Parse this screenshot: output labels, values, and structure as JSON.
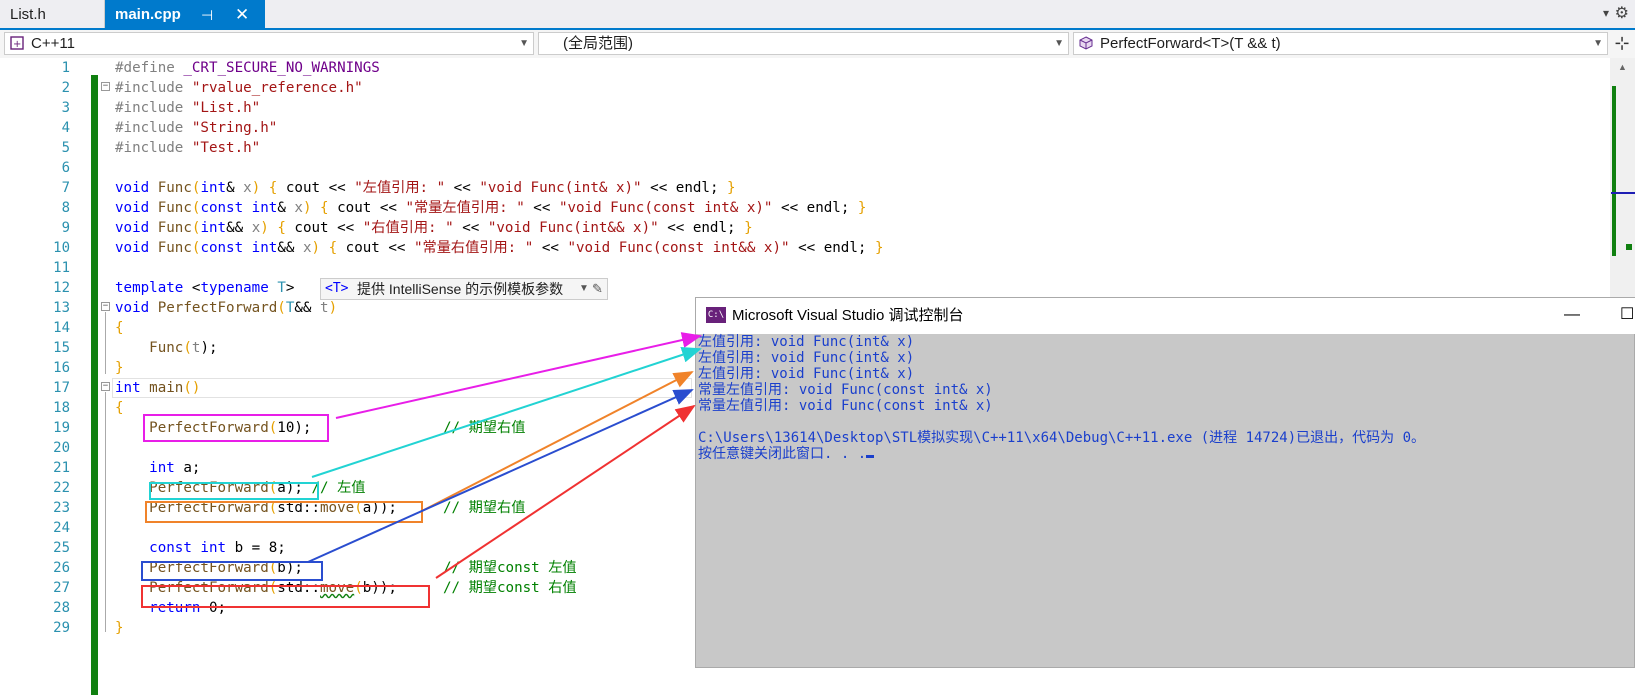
{
  "tabs": [
    {
      "label": "List.h",
      "active": false
    },
    {
      "label": "main.cpp",
      "active": true
    }
  ],
  "tab_icons": {
    "pin": "⊣",
    "close": "✕",
    "dropdown": "▾",
    "settings": "⚙"
  },
  "nav": {
    "project": "C++11",
    "scope": "(全局范围)",
    "member": "PerfectForward<T>(T && t)"
  },
  "line_numbers": [
    "1",
    "2",
    "3",
    "4",
    "5",
    "6",
    "7",
    "8",
    "9",
    "10",
    "11",
    "12",
    "13",
    "14",
    "15",
    "16",
    "17",
    "18",
    "19",
    "20",
    "21",
    "22",
    "23",
    "24",
    "25",
    "26",
    "27",
    "28",
    "29"
  ],
  "code": {
    "l1": {
      "pp": "#define ",
      "mac": "_CRT_SECURE_NO_WARNINGS"
    },
    "l2": {
      "pp": "#include ",
      "str": "\"rvalue_reference.h\""
    },
    "l3": {
      "pp": "#include ",
      "str": "\"List.h\""
    },
    "l4": {
      "pp": "#include ",
      "str": "\"String.h\""
    },
    "l5": {
      "pp": "#include ",
      "str": "\"Test.h\""
    },
    "l7": {
      "a": "void",
      "b": " Func",
      "c": "(",
      "d": "int",
      "e": "& ",
      "f": "x",
      "g": ") ",
      "h": "{",
      "i": " cout << ",
      "j": "\"左值引用: \"",
      "k": " << ",
      "l": "\"void Func(int& x)\"",
      "m": " << endl; ",
      "n": "}"
    },
    "l8": {
      "a": "void",
      "b": " Func",
      "c": "(",
      "d": "const int",
      "e": "& ",
      "f": "x",
      "g": ") ",
      "h": "{",
      "i": " cout << ",
      "j": "\"常量左值引用: \"",
      "k": " << ",
      "l": "\"void Func(const int& x)\"",
      "m": " << endl; ",
      "n": "}"
    },
    "l9": {
      "a": "void",
      "b": " Func",
      "c": "(",
      "d": "int",
      "e": "&& ",
      "f": "x",
      "g": ") ",
      "h": "{",
      "i": " cout << ",
      "j": "\"右值引用: \"",
      "k": " << ",
      "l": "\"void Func(int&& x)\"",
      "m": " << endl; ",
      "n": "}"
    },
    "l10": {
      "a": "void",
      "b": " Func",
      "c": "(",
      "d": "const int",
      "e": "&& ",
      "f": "x",
      "g": ") ",
      "h": "{",
      "i": " cout << ",
      "j": "\"常量右值引用: \"",
      "k": " << ",
      "l": "\"void Func(const int&& x)\"",
      "m": " << endl; ",
      "n": "}"
    },
    "l12": {
      "a": "template",
      "b": " <",
      "c": "typename",
      "d": " ",
      "e": "T",
      "f": ">"
    },
    "l13": {
      "a": "void",
      "b": " PerfectForward",
      "c": "(",
      "d": "T",
      "e": "&& ",
      "f": "t",
      "g": ")"
    },
    "l14": "{",
    "l15": {
      "a": "    Func",
      "b": "(",
      "c": "t",
      "d": ");"
    },
    "l16": "}",
    "l17": {
      "a": "int",
      "b": " main",
      "c": "()"
    },
    "l18": "{",
    "l19": {
      "a": "    PerfectForward",
      "b": "(",
      "c": "10",
      "d": ");",
      "cm": "// 期望右值"
    },
    "l21": {
      "a": "    int",
      "b": " a;"
    },
    "l22": {
      "a": "    PerfectForward",
      "b": "(",
      "c": "a",
      "d": ");",
      "cm": " // 左值"
    },
    "l23": {
      "a": "    PerfectForward",
      "b": "(",
      "c": "std::",
      "d": "move",
      "e": "(",
      "f": "a",
      "g": "));",
      "cm": "// 期望右值"
    },
    "l25": {
      "a": "    const int",
      "b": " b = 8;"
    },
    "l26": {
      "a": "    PerfectForward",
      "b": "(",
      "c": "b",
      "d": ");",
      "cm": "// 期望const 左值"
    },
    "l27": {
      "a": "    PerfectForward",
      "b": "(",
      "c": "std::",
      "d": "move",
      "e": "(",
      "f": "b",
      "g": "));",
      "cm": "// 期望const 右值"
    },
    "l28": {
      "a": "    return",
      "b": " 0;"
    },
    "l29": "}"
  },
  "intellisense": {
    "tag": "<T>",
    "label": "提供 IntelliSense 的示例模板参数"
  },
  "console": {
    "title": "Microsoft Visual Studio 调试控制台",
    "icon_text": "C:\\",
    "lines": [
      "左值引用: void Func(int& x)",
      "左值引用: void Func(int& x)",
      "左值引用: void Func(int& x)",
      "常量左值引用: void Func(const int& x)",
      "常量左值引用: void Func(const int& x)",
      "",
      "C:\\Users\\13614\\Desktop\\STL模拟实现\\C++11\\x64\\Debug\\C++11.exe (进程 14724)已退出，代码为 0。",
      "按任意键关闭此窗口. . ."
    ],
    "min_label": "—",
    "max_label": "☐"
  },
  "annotation_colors": {
    "magenta": "#e81ee8",
    "cyan": "#22d3d3",
    "orange": "#f0832a",
    "blue": "#2a4dcf",
    "red": "#f03232"
  }
}
